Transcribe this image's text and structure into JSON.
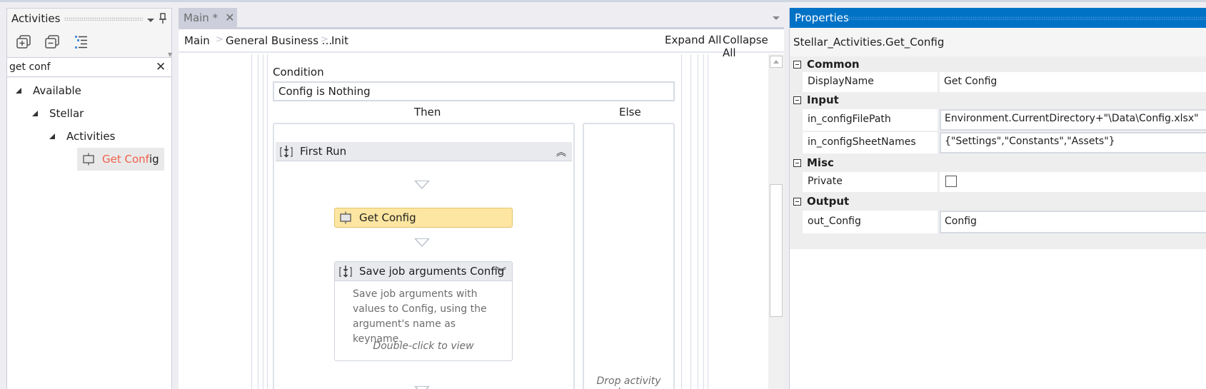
{
  "activities_panel": {
    "title": "Activities",
    "toolbar": [
      {
        "name": "expand-all-icon",
        "label": "Expand All"
      },
      {
        "name": "collapse-all-icon",
        "label": "Collapse All"
      },
      {
        "name": "show-tree-icon",
        "label": "Show Tree"
      }
    ],
    "search": {
      "value": "get conf",
      "placeholder": ""
    },
    "tree": {
      "available": "Available",
      "stellar": "Stellar",
      "activities": "Activities",
      "result_match": "Get Conf",
      "result_rest": "ig"
    }
  },
  "document_tab": {
    "label": "Main *",
    "close": "✕"
  },
  "designer": {
    "breadcrumb": [
      "Main",
      "General Business ...",
      "Init"
    ],
    "breadcrumb_sep": ">",
    "expand_all": "Expand All",
    "collapse_all": "Collapse All",
    "condition_label": "Condition",
    "condition_value": "Config is Nothing",
    "then_label": "Then",
    "else_label": "Else",
    "sequence_title": "First Run",
    "get_config_activity": "Get Config",
    "save_job_title": "Save job arguments Config",
    "save_job_description": "Save job arguments with values to Config, using the argument's name as keyname.",
    "save_job_hint": "Double-click to view",
    "else_drop_hint": "Drop activity here"
  },
  "properties": {
    "title": "Properties",
    "subject": "Stellar_Activities.Get_Config",
    "categories": {
      "common": {
        "label": "Common",
        "rows": [
          {
            "name": "DisplayName",
            "value": "Get Config"
          }
        ]
      },
      "input": {
        "label": "Input",
        "rows": [
          {
            "name": "in_configFilePath",
            "value": "Environment.CurrentDirectory+\"\\Data\\Config.xlsx\""
          },
          {
            "name": "in_configSheetNames",
            "value": "{\"Settings\",\"Constants\",\"Assets\"}"
          }
        ]
      },
      "misc": {
        "label": "Misc",
        "rows": [
          {
            "name": "Private",
            "checked": false
          }
        ]
      },
      "output": {
        "label": "Output",
        "rows": [
          {
            "name": "out_Config",
            "value": "Config"
          }
        ]
      }
    }
  },
  "colors": {
    "properties_header": "#0072c6",
    "selected_activity": "#fde6a1",
    "search_highlight": "#f0604c"
  }
}
